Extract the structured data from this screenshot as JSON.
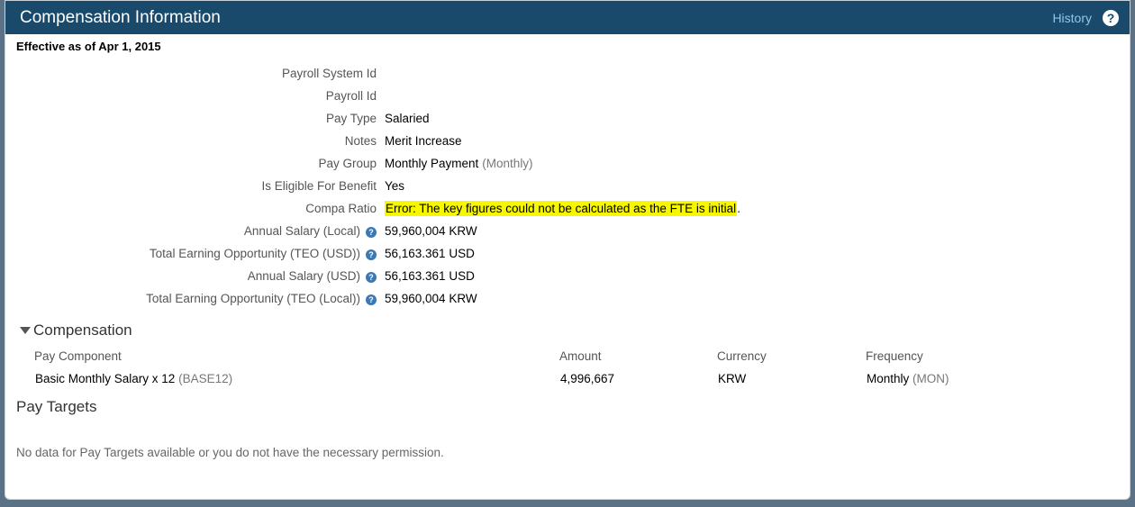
{
  "header": {
    "title": "Compensation Information",
    "history_label": "History",
    "help_glyph": "?"
  },
  "effective_label": "Effective as of Apr 1, 2015",
  "info_glyph": "?",
  "fields": [
    {
      "label": "Payroll System Id",
      "value": "",
      "extra": "",
      "info": false,
      "highlight": false
    },
    {
      "label": "Payroll Id",
      "value": "",
      "extra": "",
      "info": false,
      "highlight": false
    },
    {
      "label": "Pay Type",
      "value": "Salaried",
      "extra": "",
      "info": false,
      "highlight": false
    },
    {
      "label": "Notes",
      "value": "Merit Increase",
      "extra": "",
      "info": false,
      "highlight": false
    },
    {
      "label": "Pay Group",
      "value": "Monthly Payment",
      "extra": "(Monthly)",
      "info": false,
      "highlight": false
    },
    {
      "label": "Is Eligible For Benefit",
      "value": "Yes",
      "extra": "",
      "info": false,
      "highlight": false
    },
    {
      "label": "Compa Ratio",
      "value": "Error: The key figures could not be calculated as the FTE is initial",
      "extra": ".",
      "info": false,
      "highlight": true
    },
    {
      "label": "Annual Salary (Local)",
      "value": "59,960,004 KRW",
      "extra": "",
      "info": true,
      "highlight": false
    },
    {
      "label": "Total Earning Opportunity (TEO (USD))",
      "value": "56,163.361 USD",
      "extra": "",
      "info": true,
      "highlight": false
    },
    {
      "label": "Annual Salary (USD)",
      "value": "56,163.361 USD",
      "extra": "",
      "info": true,
      "highlight": false
    },
    {
      "label": "Total Earning Opportunity (TEO (Local))",
      "value": "59,960,004 KRW",
      "extra": "",
      "info": true,
      "highlight": false
    }
  ],
  "compensation": {
    "title": "Compensation",
    "columns": {
      "component": "Pay Component",
      "amount": "Amount",
      "currency": "Currency",
      "frequency": "Frequency"
    },
    "rows": [
      {
        "component": "Basic Monthly Salary x 12",
        "component_code": "(BASE12)",
        "amount": "4,996,667",
        "currency": "KRW",
        "frequency": "Monthly",
        "frequency_code": "(MON)"
      }
    ]
  },
  "pay_targets": {
    "title": "Pay Targets",
    "empty_message": "No data for Pay Targets available or you do not have the necessary permission."
  },
  "colors": {
    "header_bg": "#1a4a6b",
    "link": "#8fc6ea",
    "highlight": "#f7f700",
    "info_icon": "#3b79b6"
  }
}
